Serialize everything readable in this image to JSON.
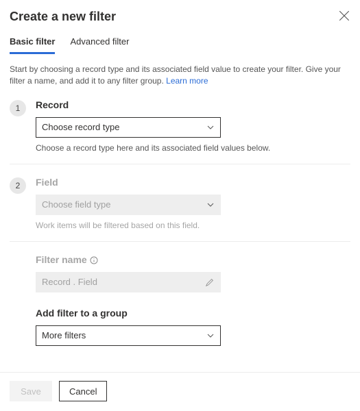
{
  "header": {
    "title": "Create a new filter"
  },
  "tabs": {
    "basic": "Basic filter",
    "advanced": "Advanced filter"
  },
  "intro": {
    "text": "Start by choosing a record type and its associated field value to create your filter. Give your filter a name, and add it to any filter group. ",
    "link": "Learn more"
  },
  "steps": {
    "record": {
      "num": "1",
      "label": "Record",
      "placeholder": "Choose record type",
      "hint": "Choose a record type here and its associated field values below."
    },
    "field": {
      "num": "2",
      "label": "Field",
      "placeholder": "Choose field type",
      "hint": "Work items will be filtered based on this field."
    },
    "name": {
      "label": "Filter name",
      "placeholder": "Record . Field"
    },
    "group": {
      "label": "Add filter to a group",
      "value": "More filters"
    }
  },
  "footer": {
    "save": "Save",
    "cancel": "Cancel"
  }
}
